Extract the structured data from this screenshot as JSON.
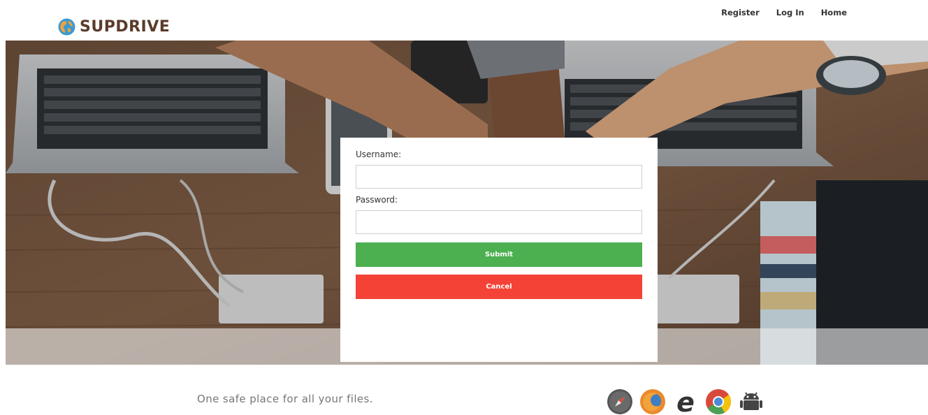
{
  "header": {
    "logo_text": "SUPDRIVE",
    "nav": [
      "Register",
      "Log In",
      "Home"
    ]
  },
  "form": {
    "username_label": "Username:",
    "password_label": "Password:",
    "username_value": "",
    "password_value": "",
    "submit_label": "Submit",
    "cancel_label": "Cancel"
  },
  "footer": {
    "tagline": "One safe place for all your files.",
    "browser_icons": [
      "safari-icon",
      "firefox-icon",
      "internet-explorer-icon",
      "chrome-icon",
      "android-icon"
    ]
  },
  "colors": {
    "submit": "#4caf50",
    "cancel": "#f44336",
    "logo_text": "#5a3b2a"
  }
}
